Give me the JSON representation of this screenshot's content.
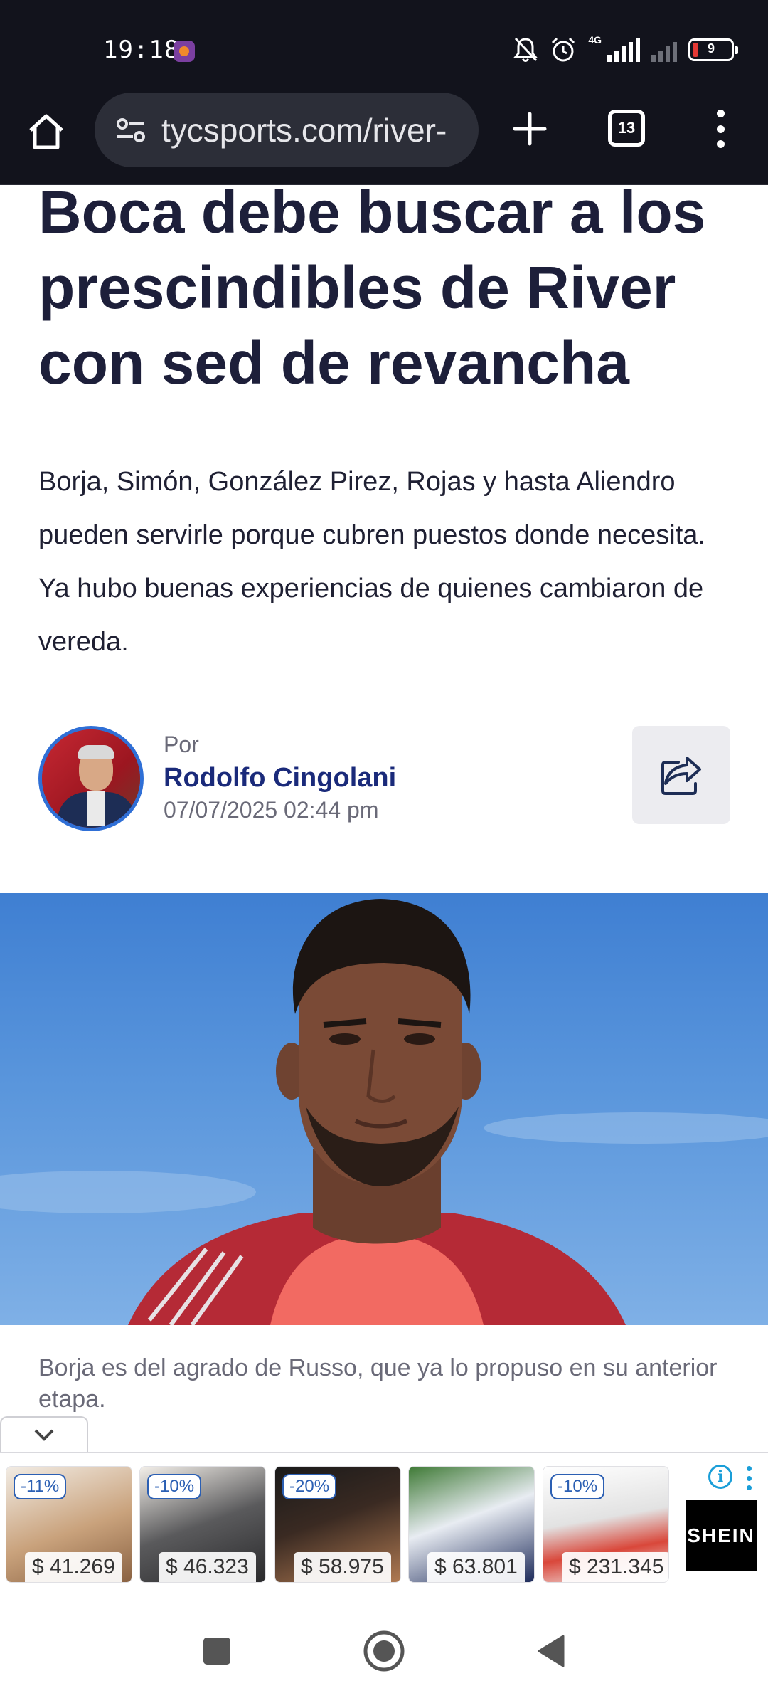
{
  "status_bar": {
    "time": "19:18",
    "network_label": "4G",
    "battery_level": "9"
  },
  "browser": {
    "url": "tycsports.com/river-",
    "tab_count": "13"
  },
  "article": {
    "headline": "Boca debe buscar a los prescindibles de River con sed de revancha",
    "lede": "Borja, Simón, González Pirez, Rojas y hasta Aliendro pueden servirle porque cubren puestos donde necesita. Ya hubo buenas experiencias de quienes cambiaron de vereda.",
    "author_prefix": "Por",
    "author_name": "Rodolfo Cingolani",
    "date": "07/07/2025 02:44 pm",
    "caption": "Borja es del agrado de Russo, que ya lo propuso en su anterior etapa."
  },
  "ad": {
    "items": [
      {
        "discount": "-11%",
        "price": "$ 41.269"
      },
      {
        "discount": "-10%",
        "price": "$ 46.323"
      },
      {
        "discount": "-20%",
        "price": "$ 58.975"
      },
      {
        "discount": "",
        "price": "$ 63.801"
      },
      {
        "discount": "-10%",
        "price": "$ 231.345"
      }
    ],
    "brand": "SHEIN",
    "info_glyph": "i"
  },
  "colors": {
    "status_bg": "#12131c",
    "headline": "#1d1f3a",
    "author_link": "#1a2a7a",
    "accent_blue": "#2f6fd6"
  }
}
